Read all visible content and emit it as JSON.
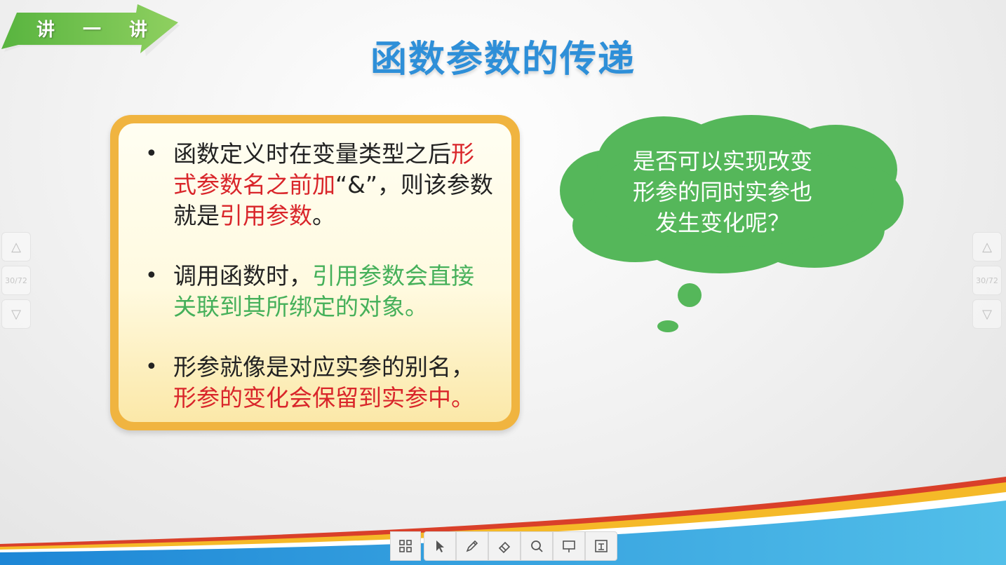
{
  "banner": {
    "chars": [
      "讲",
      "一",
      "讲"
    ]
  },
  "title": "函数参数的传递",
  "bullets": [
    {
      "segments": [
        {
          "text": "函数定义时在变量类型之后",
          "color": "normal"
        },
        {
          "text": "形式参数名之前加",
          "color": "red"
        },
        {
          "text": "“&”，则该参数就是",
          "color": "normal"
        },
        {
          "text": "引用参数",
          "color": "red"
        },
        {
          "text": "。",
          "color": "normal"
        }
      ]
    },
    {
      "segments": [
        {
          "text": "调用函数时，",
          "color": "normal"
        },
        {
          "text": "引用参数会直接关联到其所绑定的对象。",
          "color": "green"
        }
      ]
    },
    {
      "segments": [
        {
          "text": "形参就像是对应实参的别名，",
          "color": "normal"
        },
        {
          "text": "形参的变化会保留到实参中。",
          "color": "red"
        }
      ]
    }
  ],
  "cloud": {
    "lines": [
      "是否可以实现改变",
      "形参的同时实参也",
      "发生变化呢？"
    ]
  },
  "nav": {
    "page_left": "30/72",
    "page_right": "30/72"
  },
  "toolbar": {
    "items": [
      "grid-icon",
      "pointer-icon",
      "pen-icon",
      "eraser-icon",
      "zoom-icon",
      "board-icon",
      "screen-icon"
    ]
  },
  "colors": {
    "title_blue": "#2e8fd8",
    "highlight_red": "#d9252a",
    "highlight_green": "#45b05a",
    "cloud_green": "#55b75a",
    "panel_border": "#f0b440"
  }
}
